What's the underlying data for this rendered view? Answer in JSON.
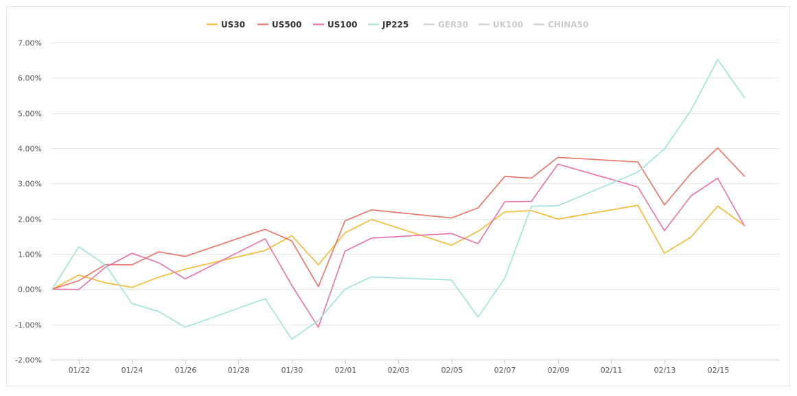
{
  "chart_data": {
    "type": "line",
    "title": "",
    "xlabel": "",
    "ylabel": "",
    "ylim": [
      -2.0,
      7.0
    ],
    "y_ticks": [
      "7.00%",
      "6.00%",
      "5.00%",
      "4.00%",
      "3.00%",
      "2.00%",
      "1.00%",
      "0.00%",
      "-1.00%",
      "-2.00%"
    ],
    "y_tick_values": [
      7,
      6,
      5,
      4,
      3,
      2,
      1,
      0,
      -1,
      -2
    ],
    "x_ticks": [
      "01/22",
      "01/24",
      "01/26",
      "01/28",
      "01/30",
      "02/01",
      "02/03",
      "02/05",
      "02/07",
      "02/09",
      "02/11",
      "02/13",
      "02/15"
    ],
    "x_tick_values": [
      "01/22",
      "01/24",
      "01/26",
      "01/28",
      "01/30",
      "02/01",
      "02/03",
      "02/05",
      "02/07",
      "02/09",
      "02/11",
      "02/13",
      "02/15"
    ],
    "x": [
      "01/21",
      "01/22",
      "01/23",
      "01/24",
      "01/25",
      "01/26",
      "01/29",
      "01/30",
      "01/31",
      "02/01",
      "02/02",
      "02/05",
      "02/06",
      "02/07",
      "02/08",
      "02/09",
      "02/12",
      "02/13",
      "02/14",
      "02/15",
      "02/16"
    ],
    "grid": true,
    "legend_position": "top-center",
    "series": [
      {
        "name": "US30",
        "color": "#f5b82e",
        "visible": true,
        "values": [
          0.0,
          0.4,
          0.18,
          0.05,
          0.34,
          0.57,
          1.1,
          1.52,
          0.69,
          1.6,
          1.98,
          1.25,
          1.64,
          2.19,
          2.23,
          1.99,
          2.38,
          1.02,
          1.48,
          2.36,
          1.81
        ]
      },
      {
        "name": "US500",
        "color": "#ec7063",
        "visible": true,
        "values": [
          0.0,
          0.24,
          0.7,
          0.69,
          1.06,
          0.93,
          1.7,
          1.37,
          0.07,
          1.94,
          2.25,
          2.02,
          2.31,
          3.2,
          3.15,
          3.74,
          3.61,
          2.39,
          3.29,
          4.01,
          3.21
        ]
      },
      {
        "name": "US100",
        "color": "#eb6fa6",
        "visible": true,
        "values": [
          0.0,
          -0.01,
          0.62,
          1.02,
          0.75,
          0.29,
          1.43,
          0.11,
          -1.08,
          1.08,
          1.45,
          1.58,
          1.29,
          2.48,
          2.49,
          3.55,
          2.9,
          1.66,
          2.65,
          3.15,
          1.8
        ]
      },
      {
        "name": "JP225",
        "color": "#9ee3dc",
        "visible": true,
        "values": [
          0.0,
          1.2,
          0.69,
          -0.41,
          -0.63,
          -1.08,
          -0.27,
          -1.42,
          -0.89,
          0.0,
          0.35,
          0.26,
          -0.79,
          0.31,
          2.35,
          2.37,
          3.32,
          3.98,
          5.08,
          6.52,
          5.44
        ]
      },
      {
        "name": "GER30",
        "color": "#bbbbbb",
        "visible": false,
        "values": []
      },
      {
        "name": "UK100",
        "color": "#bbbbbb",
        "visible": false,
        "values": []
      },
      {
        "name": "CHINA50",
        "color": "#bbbbbb",
        "visible": false,
        "values": []
      }
    ]
  },
  "colors": {
    "grid": "#e6e6e6",
    "axis": "#c8c8c8",
    "legend_active_text": "#333333",
    "legend_inactive": "#cccccc",
    "tick_text": "#555555"
  }
}
